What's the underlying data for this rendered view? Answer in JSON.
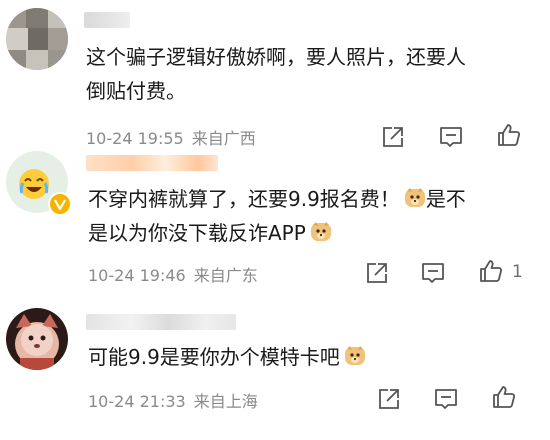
{
  "comments": [
    {
      "text_line1": "这个骗子逻辑好傲娇啊，要人照片，还要人",
      "text_line2": "倒贴付费。",
      "time": "10-24 19:55",
      "location": "来自广西",
      "likes": ""
    },
    {
      "text_line1": "不穿内裤就算了，还要9.9报名费！",
      "text_line1_after": "是不",
      "text_line2": "是以为你没下载反诈APP",
      "time": "10-24 19:46",
      "location": "来自广东",
      "likes": "1",
      "verified_color": "#f5b400"
    },
    {
      "text_line1": "可能9.9是要你办个模特卡吧",
      "time": "10-24 21:33",
      "location": "来自上海",
      "likes": ""
    }
  ],
  "icons": {
    "share": "share-icon",
    "comment": "comment-icon",
    "like": "thumbs-up-icon",
    "emoji": "doge-emoji-icon"
  },
  "colors": {
    "text": "#1a1a1a",
    "meta": "#8a8a8a",
    "icon": "#555555",
    "username_blur_orange": "#ffcfa8"
  }
}
